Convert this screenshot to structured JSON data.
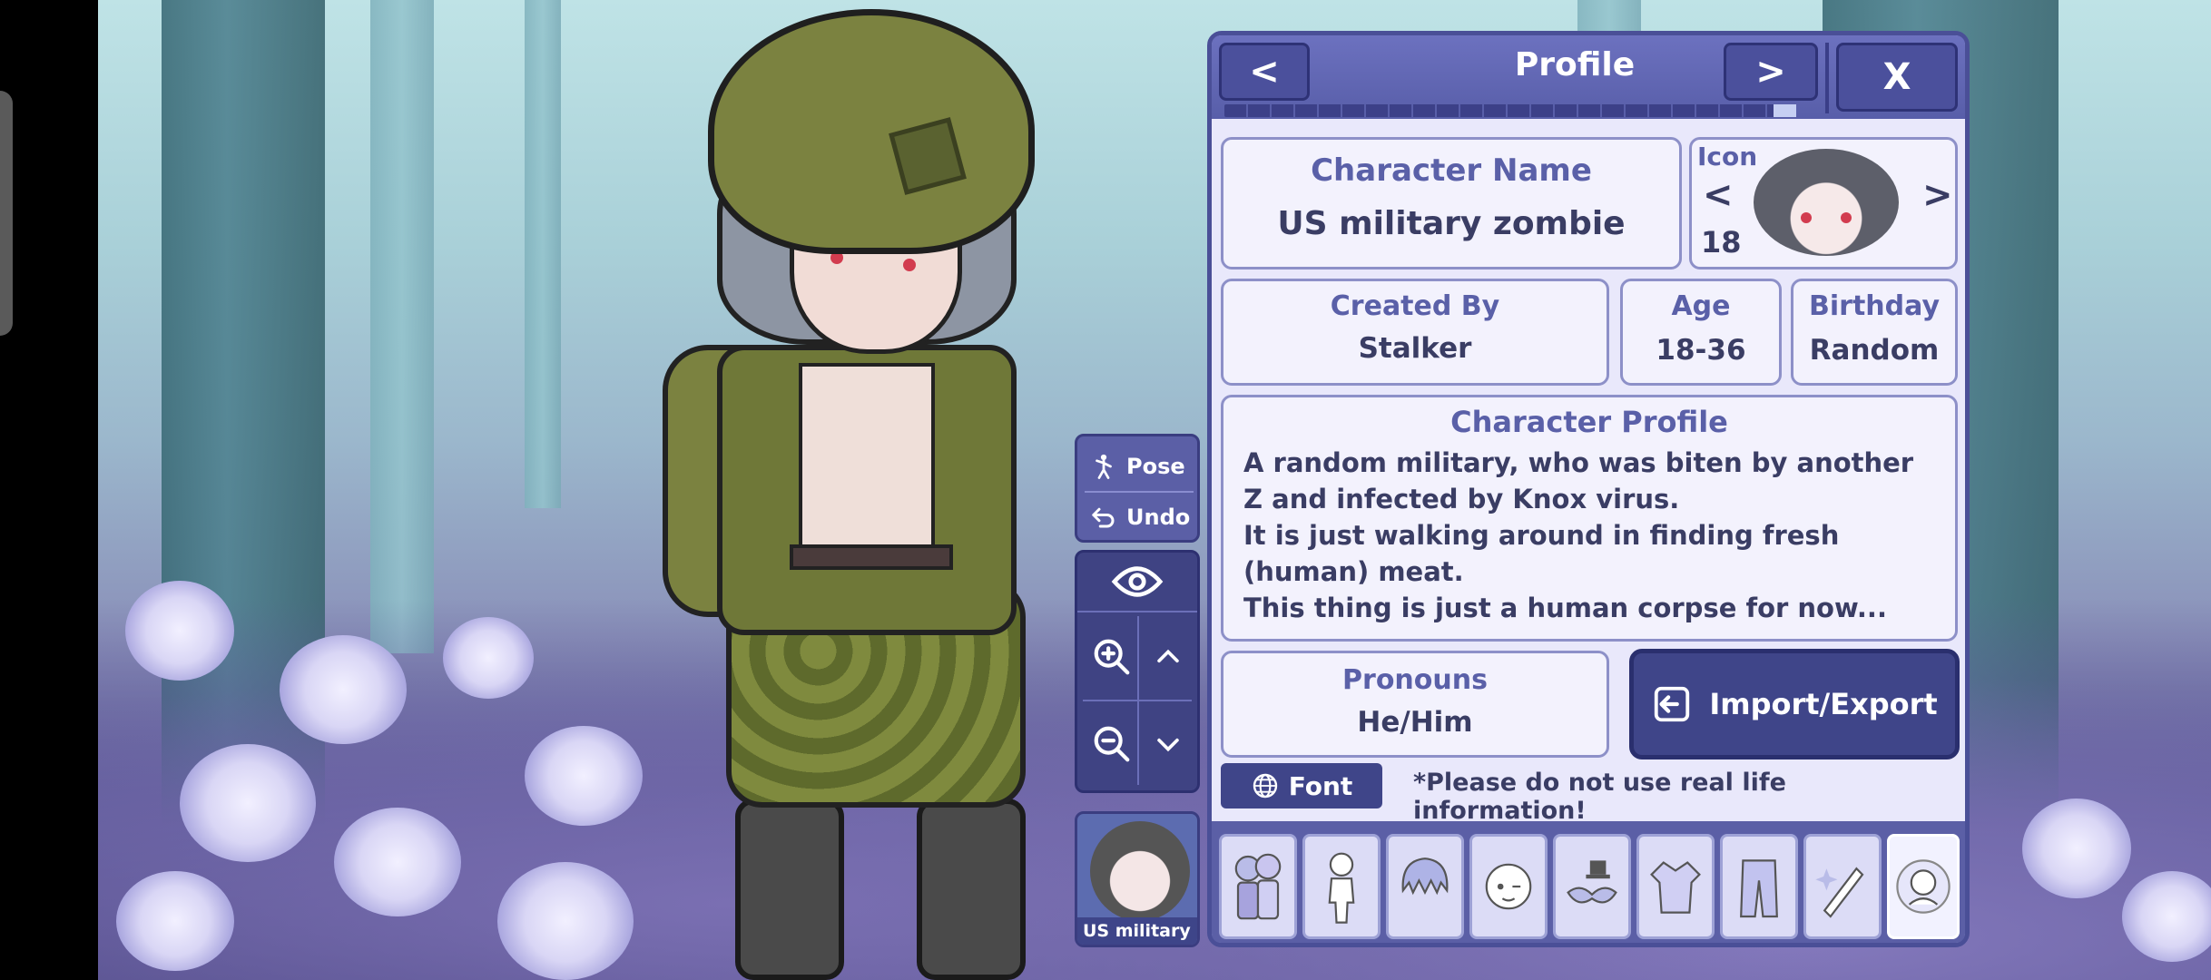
{
  "controls": {
    "pose_label": "Pose",
    "undo_label": "Undo",
    "thumbnail_label": "US military zombie"
  },
  "panel": {
    "title": "Profile",
    "prev_symbol": "<",
    "next_symbol": ">",
    "close_symbol": "X",
    "progress_fraction": 0.04,
    "character_name_label": "Character Name",
    "character_name": "US military zombie",
    "icon_label": "Icon",
    "icon_number": "18",
    "icon_prev": "<",
    "icon_next": ">",
    "created_by_label": "Created By",
    "created_by": "Stalker",
    "age_label": "Age",
    "age": "18-36",
    "birthday_label": "Birthday",
    "birthday": "Random",
    "profile_label": "Character Profile",
    "profile_text": "A random military, who was biten by another\nZ and infected by Knox virus.\nIt is just walking around in finding fresh\n(human) meat.\nThis thing is just a human corpse for now...",
    "pronouns_label": "Pronouns",
    "pronouns": "He/Him",
    "import_export_label": "Import/Export",
    "font_label": "Font",
    "notice": "*Please do not use real life information!"
  },
  "tabs": [
    {
      "icon": "characters-icon"
    },
    {
      "icon": "body-icon"
    },
    {
      "icon": "hair-icon"
    },
    {
      "icon": "face-icon"
    },
    {
      "icon": "accessories-icon"
    },
    {
      "icon": "top-clothes-icon"
    },
    {
      "icon": "bottom-clothes-icon"
    },
    {
      "icon": "props-icon"
    },
    {
      "icon": "profile-icon",
      "active": true
    }
  ],
  "colors": {
    "panel_bg": "#e9e8fb",
    "header": "#585ea9",
    "button_dark": "#3f4589",
    "text": "#3a3d64",
    "label": "#5a60a8"
  }
}
